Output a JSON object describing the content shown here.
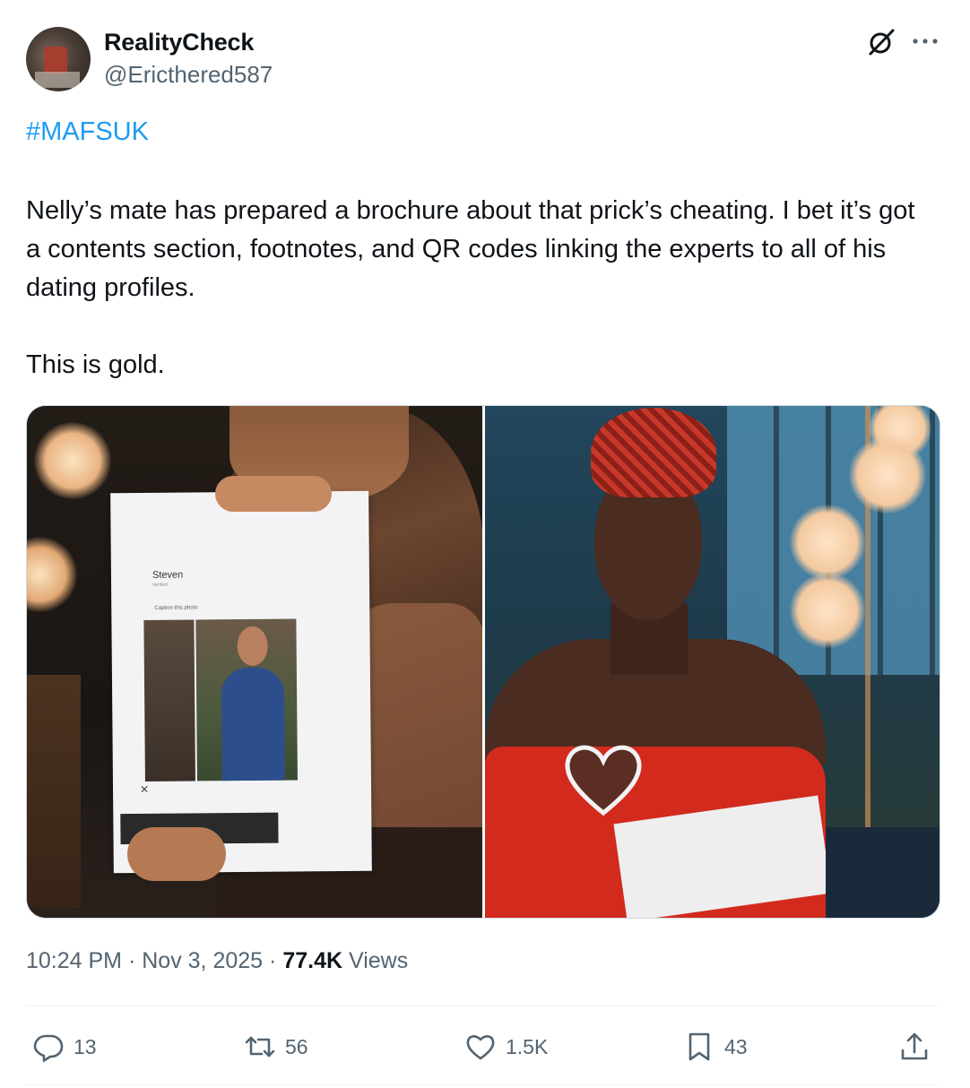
{
  "author": {
    "display_name": "RealityCheck",
    "handle": "@Ericthered587"
  },
  "tweet": {
    "hashtag": "#MAFSUK",
    "text": "Nelly’s mate has prepared a brochure about that prick’s cheating. I bet it’s got a contents section, footnotes, and QR codes linking the experts to all of his dating profiles.",
    "text2": "This is gold."
  },
  "media": {
    "left_photo": {
      "paper_name": "Steven",
      "paper_subtext": "Verified",
      "paper_caption": "Caption this photo"
    }
  },
  "meta": {
    "time": "10:24 PM",
    "date": "Nov 3, 2025",
    "views_count": "77.4K",
    "views_label": "Views",
    "separator": "·"
  },
  "actions": {
    "reply_count": "13",
    "retweet_count": "56",
    "like_count": "1.5K",
    "bookmark_count": "43"
  },
  "colors": {
    "link": "#1d9bf0",
    "secondary_text": "#536471",
    "primary_text": "#0f1419"
  }
}
